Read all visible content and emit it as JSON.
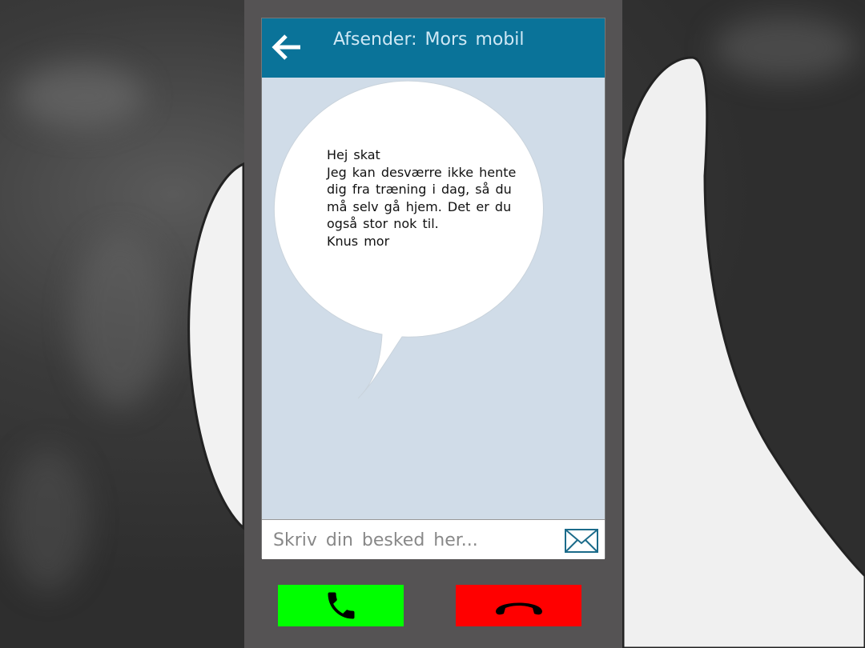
{
  "header": {
    "title": "Afsender: Mors mobil",
    "back_icon": "arrow-left-icon"
  },
  "message": {
    "text": "Hej skat\nJeg kan desværre ikke hente dig fra træning i dag, så du må selv gå hjem. Det er du også stor nok til.\nKnus mor"
  },
  "compose": {
    "placeholder": "Skriv din besked her...",
    "send_icon": "envelope-icon"
  },
  "buttons": {
    "call_icon": "phone-icon",
    "hangup_icon": "phone-hangup-icon"
  },
  "colors": {
    "header": "#0a7399",
    "screen": "#d0dce8",
    "call": "#00ff00",
    "hangup": "#ff0000",
    "phone_body": "#555354"
  }
}
